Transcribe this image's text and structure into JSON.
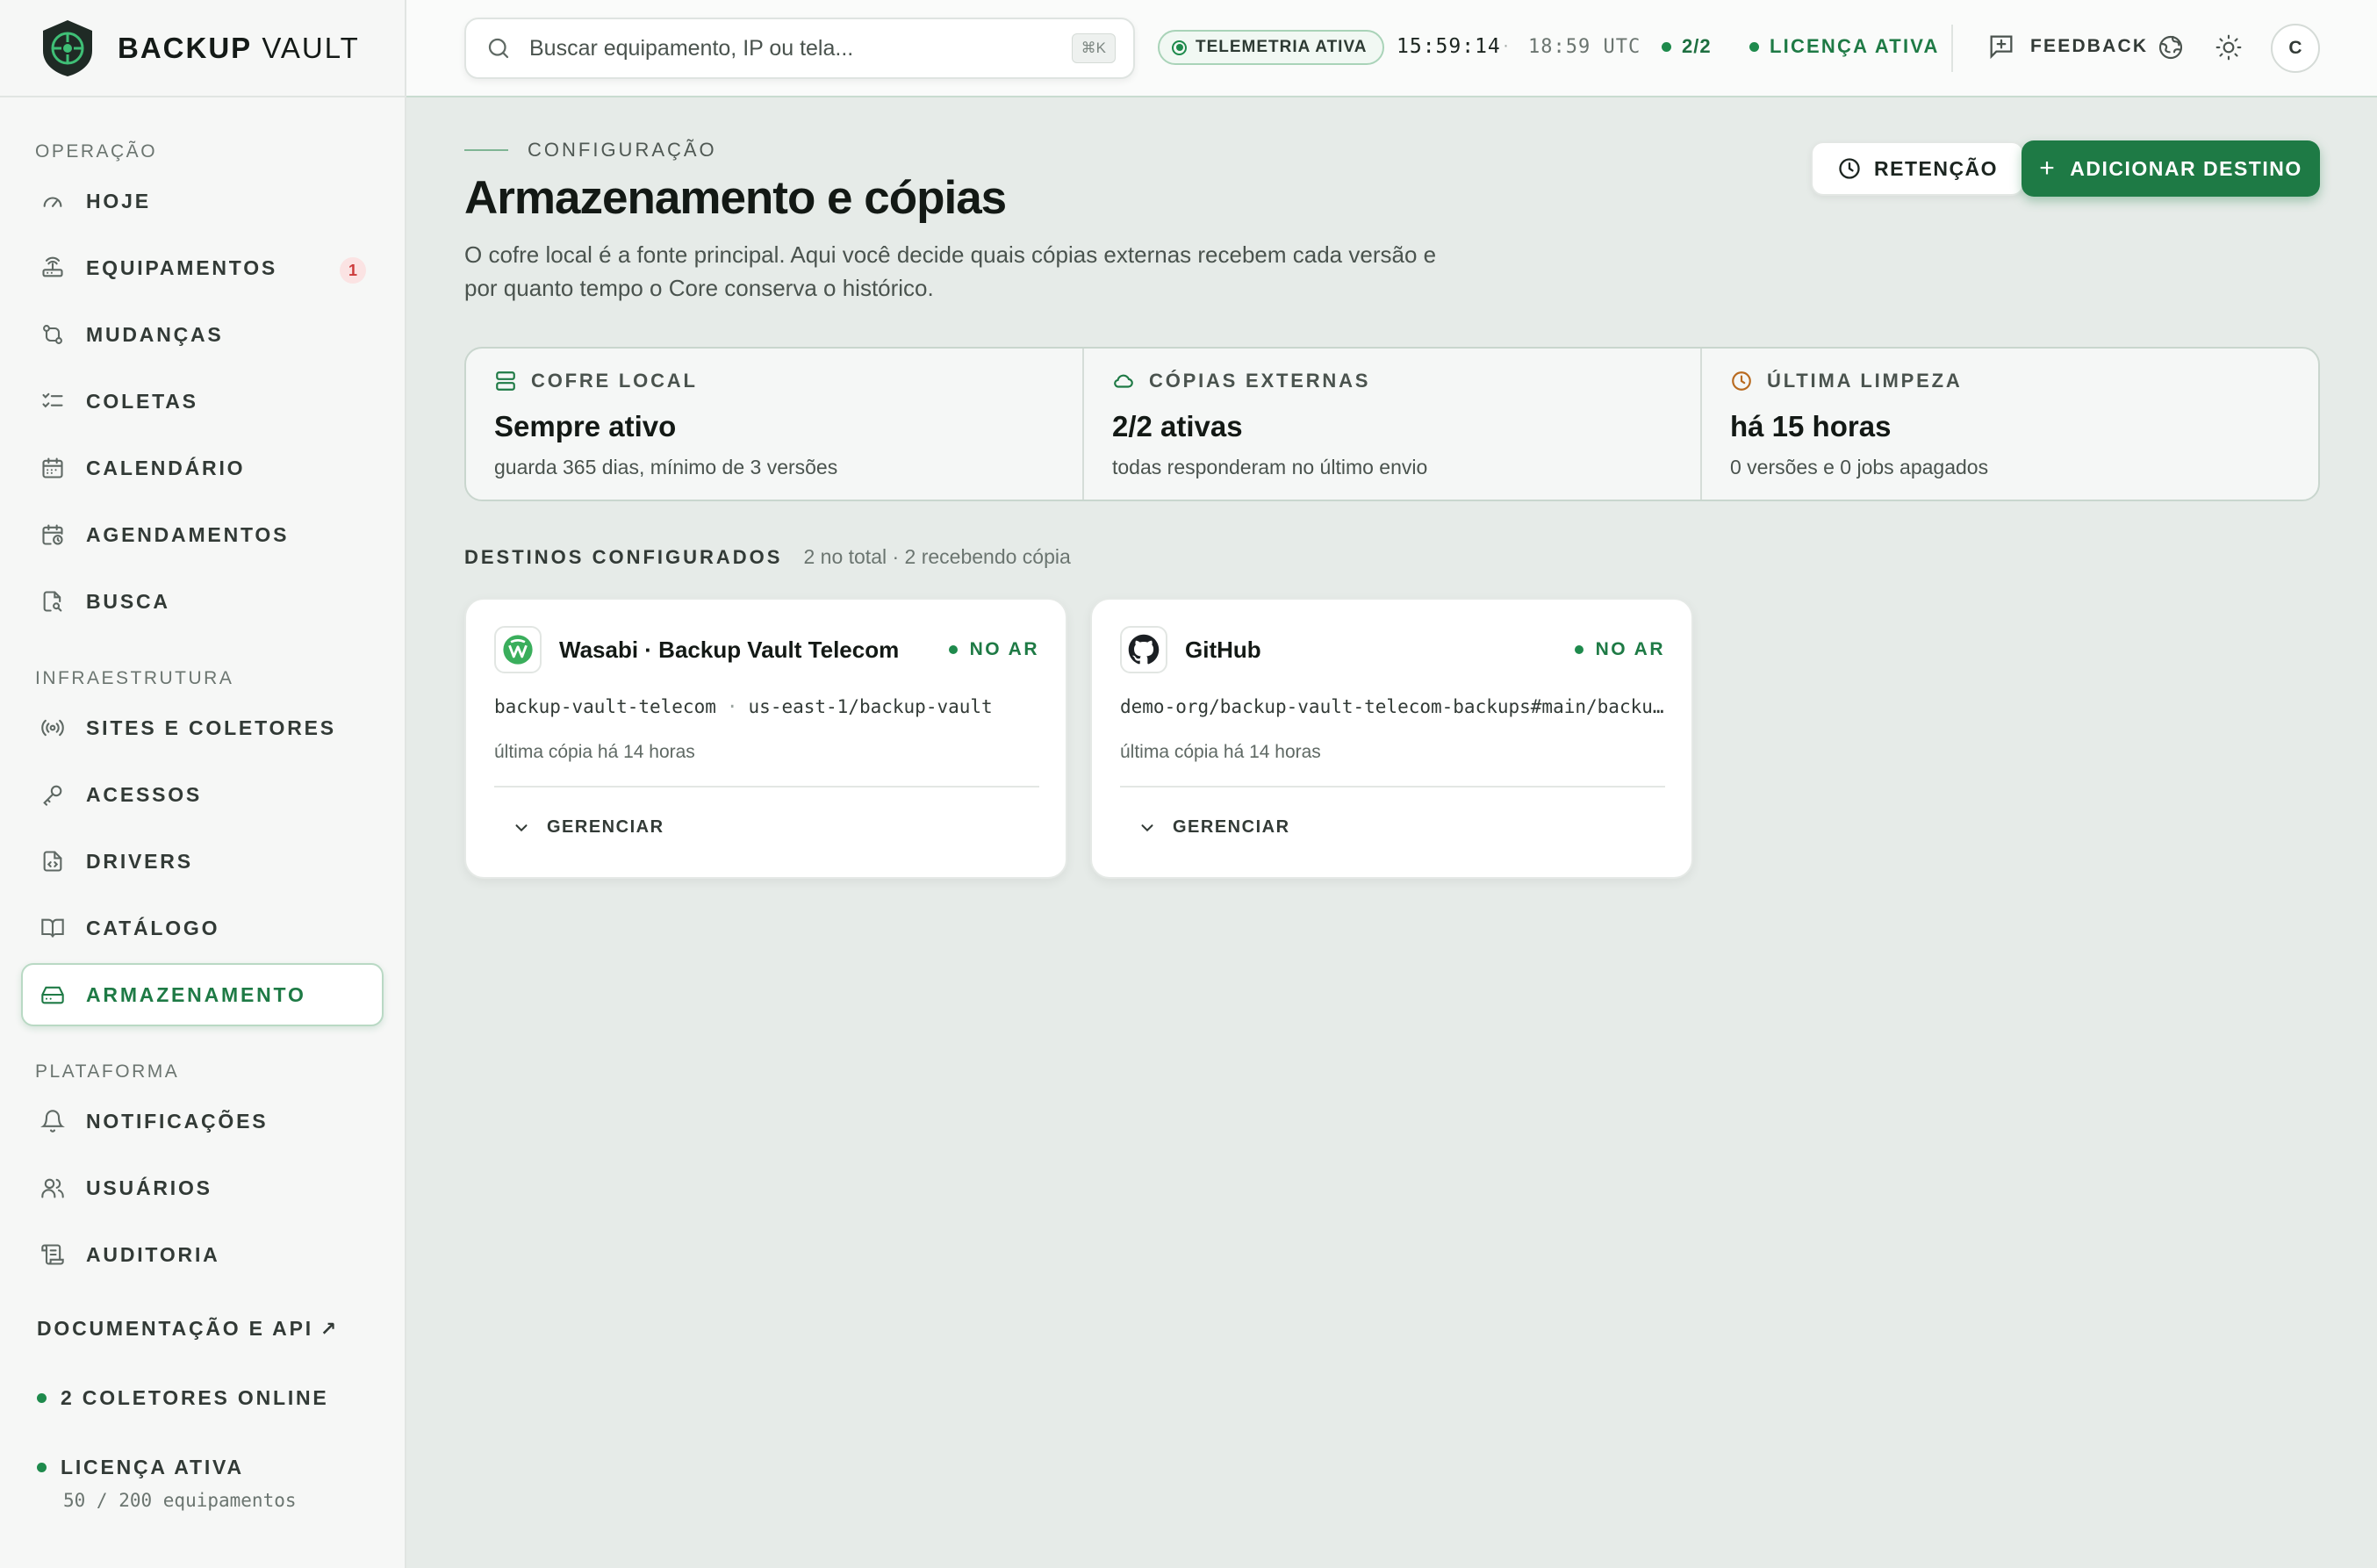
{
  "brand": {
    "name_bold": "BACKUP",
    "name_light": "VAULT"
  },
  "sidebar": {
    "sections": [
      {
        "title": "OPERAÇÃO"
      },
      {
        "title": "INFRAESTRUTURA"
      },
      {
        "title": "PLATAFORMA"
      }
    ],
    "items": [
      {
        "label": "HOJE",
        "icon": "gauge-icon"
      },
      {
        "label": "EQUIPAMENTOS",
        "icon": "router-icon",
        "badge": "1"
      },
      {
        "label": "MUDANÇAS",
        "icon": "git-compare-icon"
      },
      {
        "label": "COLETAS",
        "icon": "list-checks-icon"
      },
      {
        "label": "CALENDÁRIO",
        "icon": "calendar-icon"
      },
      {
        "label": "AGENDAMENTOS",
        "icon": "calendar-clock-icon"
      },
      {
        "label": "BUSCA",
        "icon": "file-search-icon"
      },
      {
        "label": "SITES E COLETORES",
        "icon": "radio-icon"
      },
      {
        "label": "ACESSOS",
        "icon": "key-icon"
      },
      {
        "label": "DRIVERS",
        "icon": "file-code-icon"
      },
      {
        "label": "CATÁLOGO",
        "icon": "book-icon"
      },
      {
        "label": "ARMAZENAMENTO",
        "icon": "hard-drive-icon",
        "active": true
      },
      {
        "label": "NOTIFICAÇÕES",
        "icon": "bell-icon"
      },
      {
        "label": "USUÁRIOS",
        "icon": "users-icon"
      },
      {
        "label": "AUDITORIA",
        "icon": "scroll-icon"
      }
    ],
    "footer": {
      "docs_label": "DOCUMENTAÇÃO E API",
      "collectors_label": "2 COLETORES ONLINE",
      "license_label": "LICENÇA ATIVA",
      "license_sub": "50 / 200 equipamentos"
    }
  },
  "topbar": {
    "search_placeholder": "Buscar equipamento, IP ou tela...",
    "search_shortcut": "⌘K",
    "telemetry": "TELEMETRIA ATIVA",
    "local_time": "15:59:14",
    "separator": "·",
    "utc_time": "18:59 UTC",
    "ratio": "2/2",
    "license": "LICENÇA ATIVA",
    "feedback": "FEEDBACK",
    "avatar_initial": "C",
    "colors": {
      "accent": "#1e7a45",
      "status_dot": "#1e8a4c"
    }
  },
  "page": {
    "eyebrow": "CONFIGURAÇÃO",
    "title": "Armazenamento e cópias",
    "description": "O cofre local é a fonte principal. Aqui você decide quais cópias externas recebem cada versão e por quanto tempo o Core conserva o histórico.",
    "retention_button": "RETENÇÃO",
    "add_button": "ADICIONAR DESTINO"
  },
  "stats": [
    {
      "label": "COFRE LOCAL",
      "icon": "database-icon",
      "value": "Sempre ativo",
      "sub": "guarda 365 dias, mínimo de 3 versões"
    },
    {
      "label": "CÓPIAS EXTERNAS",
      "icon": "cloud-icon",
      "value": "2/2 ativas",
      "sub": "todas responderam no último envio"
    },
    {
      "label": "ÚLTIMA LIMPEZA",
      "icon": "clock-icon",
      "value": "há 15 horas",
      "sub": "0 versões e 0 jobs apagados"
    }
  ],
  "destinations": {
    "title": "DESTINOS CONFIGURADOS",
    "meta": "2 no total · 2 recebendo cópia",
    "items": [
      {
        "name": "Wasabi · Backup Vault Telecom",
        "status": "NO AR",
        "path_a": "backup-vault-telecom",
        "path_sep": "·",
        "path_b": "us-east-1/backup-vault",
        "last_copy": "última cópia há 14 horas",
        "manage": "GERENCIAR",
        "icon": "wasabi-logo-icon"
      },
      {
        "name": "GitHub",
        "status": "NO AR",
        "path_a": "demo-org/backup-vault-telecom-backups#main/backups",
        "last_copy": "última cópia há 14 horas",
        "manage": "GERENCIAR",
        "icon": "github-logo-icon"
      }
    ]
  }
}
